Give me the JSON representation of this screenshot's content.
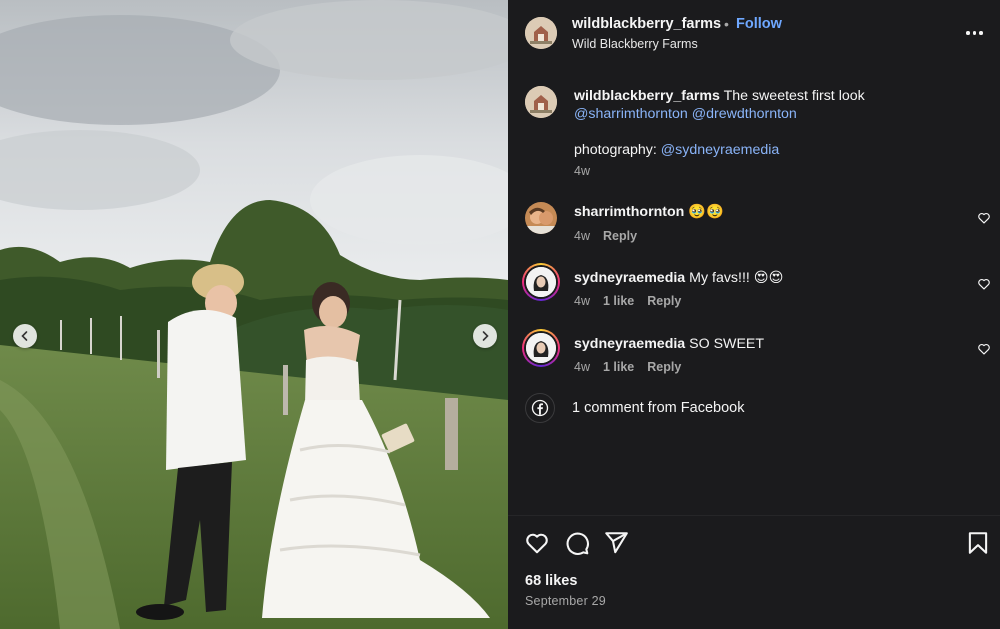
{
  "post": {
    "username": "wildblackberry_farms",
    "separator": "•",
    "follow_label": "Follow",
    "location": "Wild Blackberry Farms"
  },
  "caption": {
    "username": "wildblackberry_farms",
    "text": " The sweetest first look ",
    "mention_1": "@sharrimthornton",
    "mention_2": "@drewdthornton",
    "photo_prefix": "photography: ",
    "photo_mention": "@sydneyraemedia",
    "time": "4w"
  },
  "comments": [
    {
      "username": "sharrimthornton",
      "text": " 🥹🥹",
      "time": "4w",
      "likes": "",
      "reply_label": "Reply"
    },
    {
      "username": "sydneyraemedia",
      "text": " My favs!!! 😍😍",
      "time": "4w",
      "likes": "1 like",
      "reply_label": "Reply"
    },
    {
      "username": "sydneyraemedia",
      "text": " SO SWEET",
      "time": "4w",
      "likes": "1 like",
      "reply_label": "Reply"
    }
  ],
  "facebook": {
    "label": "1 comment from Facebook"
  },
  "stats": {
    "likes": "68 likes",
    "date": "September 29"
  },
  "icons": {
    "prev": "chevron-left-icon",
    "next": "chevron-right-icon",
    "more": "more-horizontal-icon",
    "like": "heart-icon",
    "comment": "comment-bubble-icon",
    "share": "send-icon",
    "save": "bookmark-icon",
    "facebook": "facebook-icon"
  },
  "colors": {
    "link": "#8ab4f8",
    "follow": "#6fa8ff",
    "background": "#1b1b1d",
    "muted": "#a8a8a8"
  }
}
